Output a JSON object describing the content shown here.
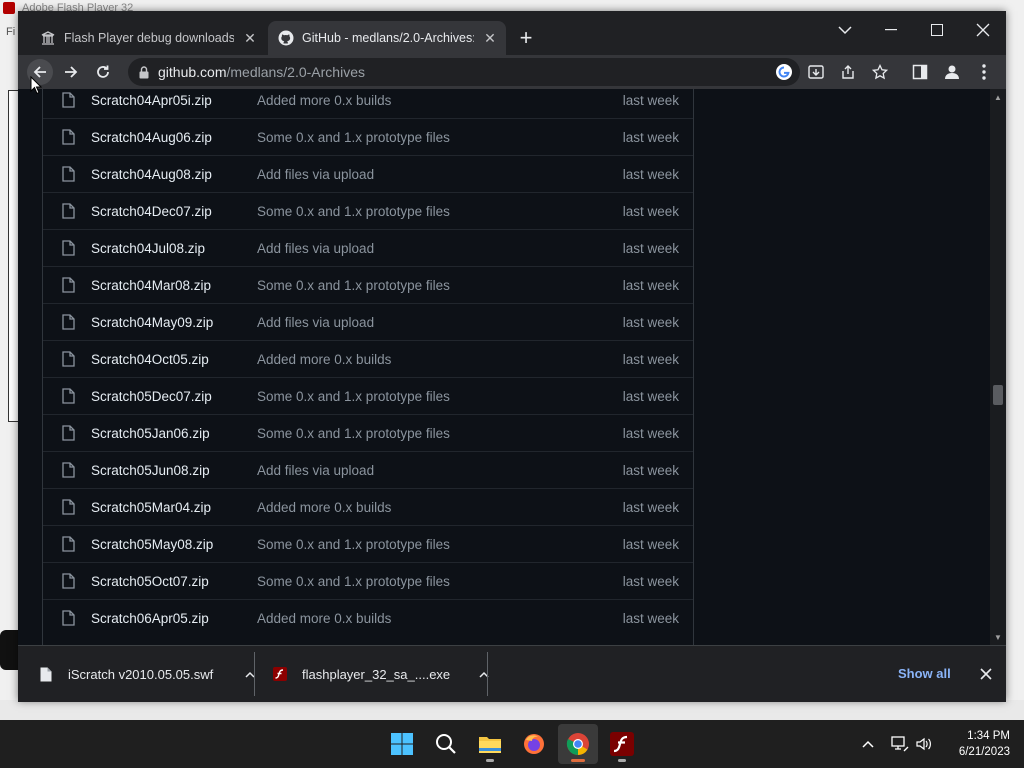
{
  "background_app": {
    "title": "Adobe Flash Player 32",
    "menu": "Fi"
  },
  "browser": {
    "tabs": [
      {
        "title": "Flash Player debug downloads - I",
        "active": false,
        "icon": "library-icon"
      },
      {
        "title": "GitHub - medlans/2.0-Archives: S",
        "active": true,
        "icon": "github-icon"
      }
    ],
    "address": {
      "domain": "github.com",
      "path": "/medlans/2.0-Archives"
    }
  },
  "files": [
    {
      "name": "Scratch04Apr05i.zip",
      "message": "Added more 0.x builds",
      "date": "last week"
    },
    {
      "name": "Scratch04Aug06.zip",
      "message": "Some 0.x and 1.x prototype files",
      "date": "last week"
    },
    {
      "name": "Scratch04Aug08.zip",
      "message": "Add files via upload",
      "date": "last week"
    },
    {
      "name": "Scratch04Dec07.zip",
      "message": "Some 0.x and 1.x prototype files",
      "date": "last week"
    },
    {
      "name": "Scratch04Jul08.zip",
      "message": "Add files via upload",
      "date": "last week"
    },
    {
      "name": "Scratch04Mar08.zip",
      "message": "Some 0.x and 1.x prototype files",
      "date": "last week"
    },
    {
      "name": "Scratch04May09.zip",
      "message": "Add files via upload",
      "date": "last week"
    },
    {
      "name": "Scratch04Oct05.zip",
      "message": "Added more 0.x builds",
      "date": "last week"
    },
    {
      "name": "Scratch05Dec07.zip",
      "message": "Some 0.x and 1.x prototype files",
      "date": "last week"
    },
    {
      "name": "Scratch05Jan06.zip",
      "message": "Some 0.x and 1.x prototype files",
      "date": "last week"
    },
    {
      "name": "Scratch05Jun08.zip",
      "message": "Add files via upload",
      "date": "last week"
    },
    {
      "name": "Scratch05Mar04.zip",
      "message": "Added more 0.x builds",
      "date": "last week"
    },
    {
      "name": "Scratch05May08.zip",
      "message": "Some 0.x and 1.x prototype files",
      "date": "last week"
    },
    {
      "name": "Scratch05Oct07.zip",
      "message": "Some 0.x and 1.x prototype files",
      "date": "last week"
    },
    {
      "name": "Scratch06Apr05.zip",
      "message": "Added more 0.x builds",
      "date": "last week"
    }
  ],
  "downloads": {
    "items": [
      {
        "name": "iScratch v2010.05.05.swf",
        "icon": "file-icon"
      },
      {
        "name": "flashplayer_32_sa_....exe",
        "icon": "flash-icon"
      }
    ],
    "show_all": "Show all"
  },
  "clock": {
    "time": "1:34 PM",
    "date": "6/21/2023"
  }
}
